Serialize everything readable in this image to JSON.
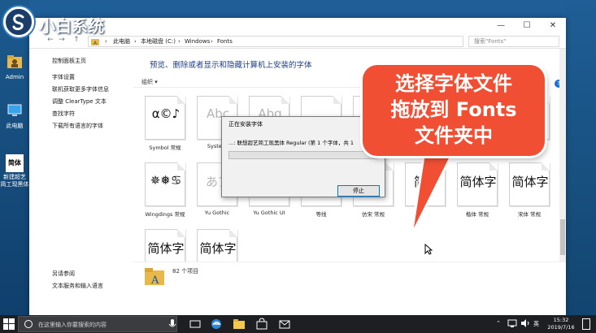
{
  "logo": {
    "text": "小白系统"
  },
  "desktop": {
    "icons": [
      {
        "label": "Admin",
        "icon": "user-folder-icon"
      },
      {
        "label": "此电脑",
        "icon": "computer-icon"
      },
      {
        "label": "新建超艺\n简工现黑体",
        "icon": "font-file-icon",
        "glyph": "简体"
      }
    ],
    "top_left_label": "回"
  },
  "window": {
    "controls": {
      "minimize": "—",
      "maximize": "☐",
      "close": "✕"
    },
    "nav": {
      "back": "←",
      "forward": "→",
      "up": "↑"
    },
    "breadcrumb": [
      "此电脑",
      "本地磁盘 (C:)",
      "Windows",
      "Fonts"
    ],
    "breadcrumb_sep": "›",
    "search_placeholder": "搜索\"Fonts\"",
    "left_pane": {
      "title": "控制面板主页",
      "links": [
        "字体设置",
        "联机获取更多字体信息",
        "调整 ClearType 文本",
        "查找字符",
        "下载所有语言的字体"
      ],
      "see_also_title": "另请参阅",
      "see_also": [
        "文本服务和输入语言"
      ]
    },
    "heading": "预览、删除或者显示和隐藏计算机上安装的字体",
    "toolbar": {
      "organize": "组织 ▾"
    },
    "help": "?",
    "tiles_row1": [
      {
        "glyph": "α©♪",
        "name": "Symbol 常规",
        "light": false
      },
      {
        "glyph": "Abc",
        "name": "System",
        "light": true
      },
      {
        "glyph": "Abg",
        "name": "",
        "light": true
      },
      {
        "glyph": "",
        "name": "",
        "light": true
      },
      {
        "glyph": "",
        "name": "",
        "light": true
      },
      {
        "glyph": "",
        "name": "",
        "light": true
      },
      {
        "glyph": "",
        "name": "",
        "light": true
      },
      {
        "glyph": "",
        "name": "",
        "light": true
      }
    ],
    "tiles_row2": [
      {
        "glyph": "✵❅♋",
        "name": "Wingdings 常规",
        "light": false
      },
      {
        "glyph": "あア",
        "name": "Yu Gothic",
        "light": true
      },
      {
        "glyph": "",
        "name": "Yu Gothic UI",
        "light": true
      },
      {
        "glyph": "",
        "name": "等线",
        "light": true
      },
      {
        "glyph": "",
        "name": "仿宋 常规",
        "light": false
      },
      {
        "glyph": "简体",
        "name": "",
        "light": false
      },
      {
        "glyph": "简体字",
        "name": "楷体 常规",
        "light": false
      },
      {
        "glyph": "简体字",
        "name": "宋体 常规",
        "light": false
      }
    ],
    "tiles_row3": [
      {
        "glyph": "简体字",
        "name": "微软雅黑",
        "light": false
      },
      {
        "glyph": "简体字",
        "name": "新宋体 常规",
        "light": false
      }
    ],
    "status_text": "82 个项目"
  },
  "dialog": {
    "title": "正在安装字体",
    "message": "...: 联想超艺简工现黑体 Regular (第 1 个字体，共 1",
    "stop_label": "停止"
  },
  "callout": {
    "lines": [
      "选择字体文件",
      "拖放到 Fonts",
      "文件夹中"
    ],
    "color": "#f04f34"
  },
  "taskbar": {
    "search_placeholder": "在这里输入你要搜索的内容",
    "ime": "英",
    "time": "15:32",
    "date": "2019/7/16"
  }
}
